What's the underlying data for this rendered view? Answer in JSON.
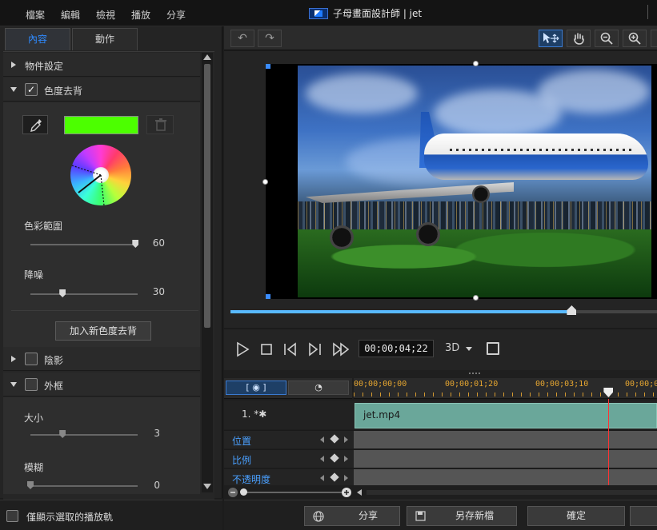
{
  "menubar": {
    "items": [
      "檔案",
      "編輯",
      "檢視",
      "播放",
      "分享"
    ],
    "title": "子母畫面設計師 | jet"
  },
  "left_panel": {
    "tabs": [
      "內容",
      "動作"
    ],
    "active_tab": 0,
    "sections": {
      "object_settings": "物件設定",
      "chroma_key": "色度去背",
      "color_range_label": "色彩範圍",
      "color_range_value": "60",
      "color_range_fraction": 0.98,
      "denoise_label": "降噪",
      "denoise_value": "30",
      "denoise_fraction": 0.3,
      "add_chroma_button": "加入新色度去背",
      "shadow": "陰影",
      "border": "外框",
      "size_label": "大小",
      "size_value": "3",
      "size_fraction": 0.3,
      "blur_label": "模糊",
      "blur_value": "0",
      "blur_fraction": 0.0
    },
    "key_color": "#4cff00",
    "chroma_checked": true,
    "shadow_checked": false,
    "border_checked": false
  },
  "bottom_left": {
    "show_selected_only": "僅顯示選取的播放軌"
  },
  "player": {
    "timecode": "00;00;04;22",
    "mode": "3D",
    "scrub_fraction": 0.8
  },
  "timeline": {
    "ruler_labels": [
      "00;00;00;00",
      "00;00;01;20",
      "00;00;03;10",
      "00;00;05"
    ],
    "track_label": "1. *",
    "clip_name": "jet.mp4",
    "keyframe_rows": [
      "位置",
      "比例",
      "不透明度"
    ],
    "playhead_fraction": 0.84
  },
  "footer": {
    "share": "分享",
    "save_as": "另存新檔",
    "ok": "確定"
  },
  "colors": {
    "accent": "#2f8bff",
    "clip": "#6aa79a",
    "playhead": "#ff3333",
    "ruler_text": "#e6a630"
  }
}
